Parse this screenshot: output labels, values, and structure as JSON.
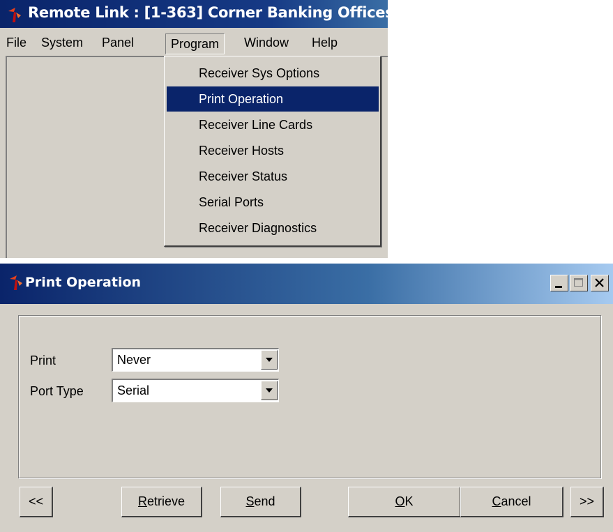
{
  "main_window": {
    "title": "Remote Link : [1-363] Corner Banking Offices",
    "menubar": [
      "File",
      "System",
      "Panel",
      "Program",
      "Window",
      "Help"
    ],
    "open_menu": "Program",
    "program_menu": [
      "Receiver Sys Options",
      "Print Operation",
      "Receiver Line Cards",
      "Receiver Hosts",
      "Receiver Status",
      "Serial Ports",
      "Receiver Diagnostics"
    ],
    "highlighted_item": "Print Operation"
  },
  "dialog": {
    "title": "Print Operation",
    "fields": {
      "print_label": "Print",
      "print_value": "Never",
      "port_type_label": "Port Type",
      "port_type_value": "Serial"
    },
    "buttons": {
      "prev": "<<",
      "retrieve_accel": "R",
      "retrieve_rest": "etrieve",
      "send_accel": "S",
      "send_rest": "end",
      "ok_accel": "O",
      "ok_rest": "K",
      "cancel_accel": "C",
      "cancel_rest": "ancel",
      "next": ">>"
    }
  },
  "colors": {
    "title_active": "#0a246a",
    "face": "#d4d0c8",
    "highlight": "#0a246a"
  }
}
